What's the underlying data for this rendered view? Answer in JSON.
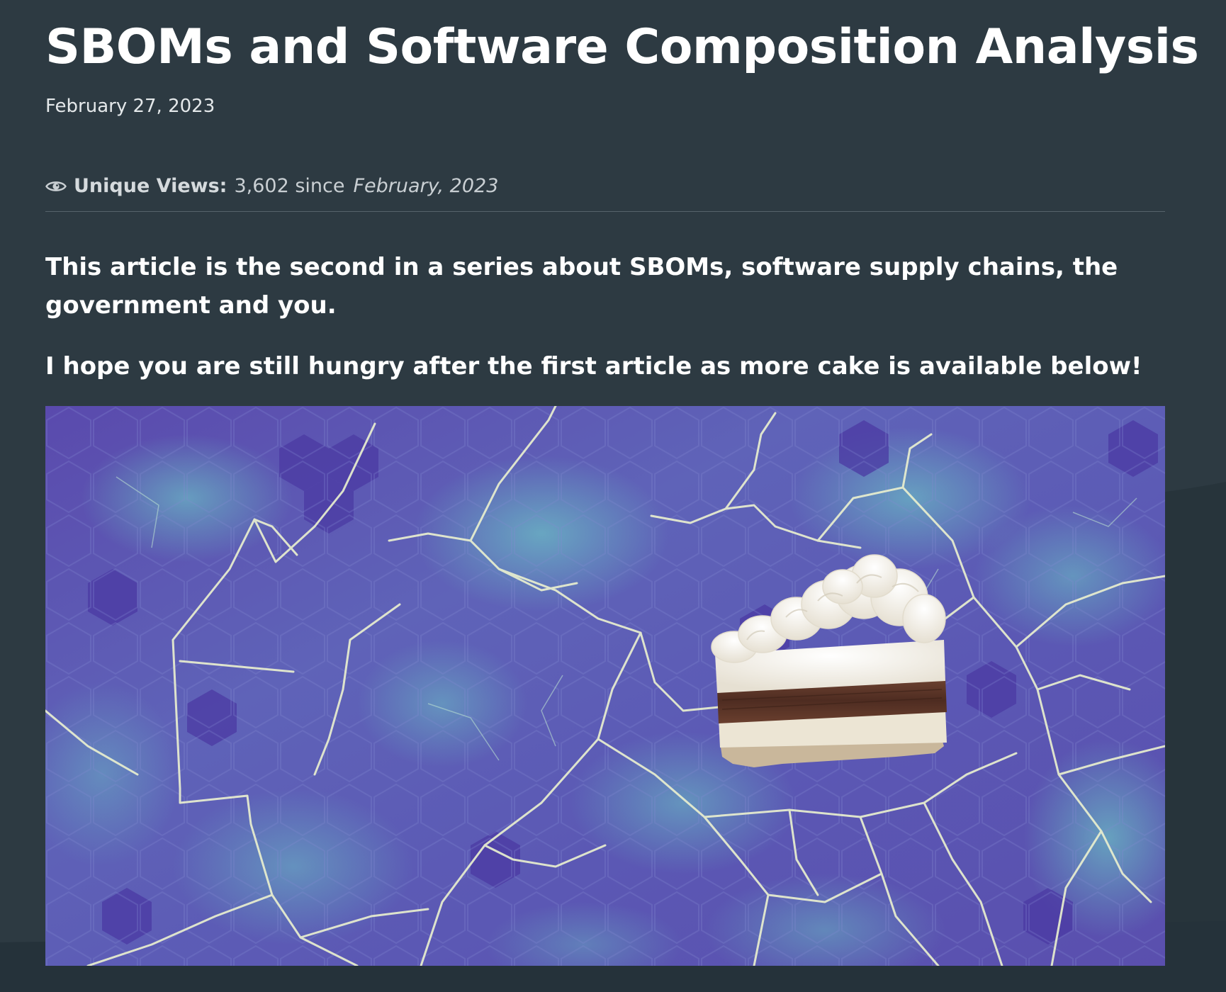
{
  "article": {
    "title": "SBOMs and Software Composition Analysis",
    "date": "February 27, 2023",
    "views": {
      "icon": "eye-icon",
      "label": "Unique Views:",
      "count": "3,602 since",
      "since_date": "February, 2023"
    },
    "intro": "This article is the second in a series about SBOMs, software supply chains, the government and you.",
    "hungry": "I hope you are still hungry after the first article as more cake is available below!"
  },
  "colors": {
    "page_background": "#2d3a42",
    "text": "#ffffff",
    "muted_text": "#c9cfd3",
    "image_purple": "#5a4fb0",
    "image_teal": "#5fb8c2"
  }
}
